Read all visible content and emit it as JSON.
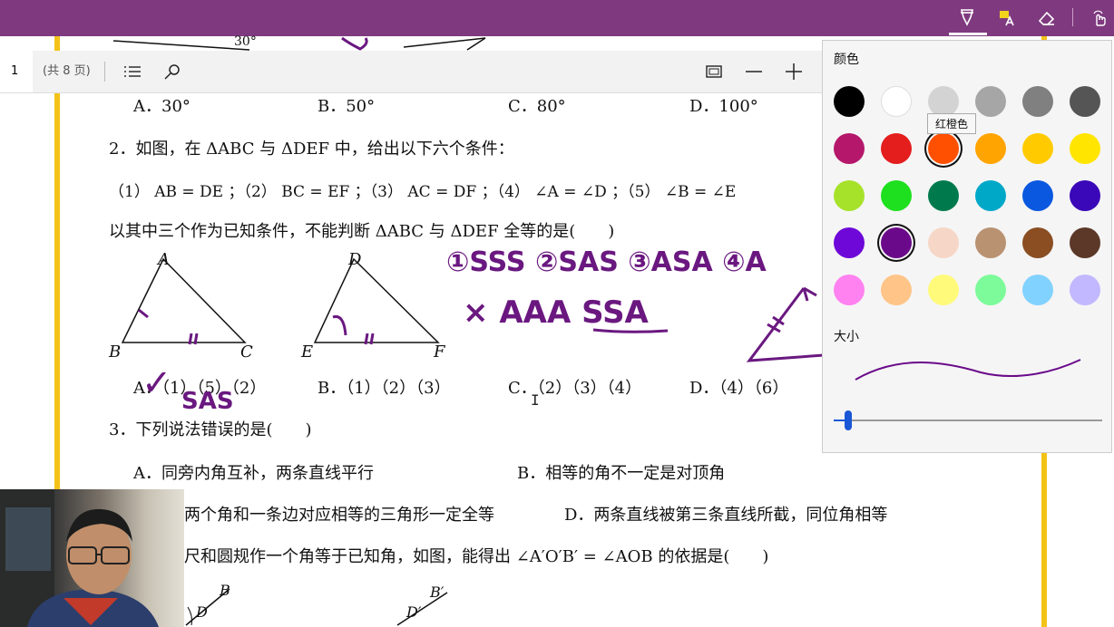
{
  "toolbar": {
    "page_number": "1",
    "page_count": "(共 8 页)"
  },
  "panel": {
    "color_title": "颜色",
    "size_title": "大小",
    "tooltip": "红橙色",
    "colors": [
      "#000000",
      "#ffffff",
      "#d3d3d3",
      "#a6a6a6",
      "#808080",
      "#555555",
      "#b5186a",
      "#e41d1d",
      "#ff4f00",
      "#ffa400",
      "#ffcb00",
      "#ffe500",
      "#a6e22a",
      "#1ee01e",
      "#007a4d",
      "#00a8c8",
      "#0a58e0",
      "#3a08b8",
      "#6d08d8",
      "#6a0a8a",
      "#f6d6c6",
      "#b99272",
      "#8a4e22",
      "#5c3828",
      "#ff82f0",
      "#ffc487",
      "#fffa7a",
      "#7dfa9a",
      "#82d2ff",
      "#c2b8ff"
    ],
    "selected_colors": [
      8,
      19
    ]
  },
  "doc": {
    "q1_opts": [
      "A．30°",
      "B．50°",
      "C．80°",
      "D．100°"
    ],
    "q2_stem": "2．如图，在 ΔABC 与 ΔDEF 中，给出以下六个条件：",
    "q2_conds": "（1） AB = DE ；（2） BC = EF ；（3） AC = DF ；（4） ∠A = ∠D ；（5） ∠B = ∠E",
    "q2_ask": "以其中三个作为已知条件，不能判断 ΔABC 与 ΔDEF 全等的是(　　)",
    "q2_A": "A．（1）（5）（2）",
    "q2_B": "B．（1）（2）（3）",
    "q2_C": "C．（2）（3）（4）",
    "q2_D": "D．（4）（6）",
    "q3_stem": "3．下列说法错误的是(　　)",
    "q3_A": "A．同旁内角互补，两条直线平行",
    "q3_B": "B．相等的角不一定是对顶角",
    "q3_C": "两个角和一条边对应相等的三角形一定全等",
    "q3_D": "D．两条直线被第三条直线所截，同位角相等",
    "q4_stem": "尺和圆规作一个角等于已知角，如图，能得出 ∠A′O′B′ = ∠AOB 的依据是(　　)",
    "top_label": "30°",
    "fig_labels": [
      "A",
      "B",
      "C",
      "D",
      "E",
      "F"
    ],
    "fig2_labels": [
      "B",
      "D",
      "B′",
      "D′"
    ]
  },
  "ink": {
    "line1": "①SSS ②SAS ③ASA ④A",
    "line2": "× AAA  SSA",
    "check": "✓",
    "sas": "SAS"
  }
}
